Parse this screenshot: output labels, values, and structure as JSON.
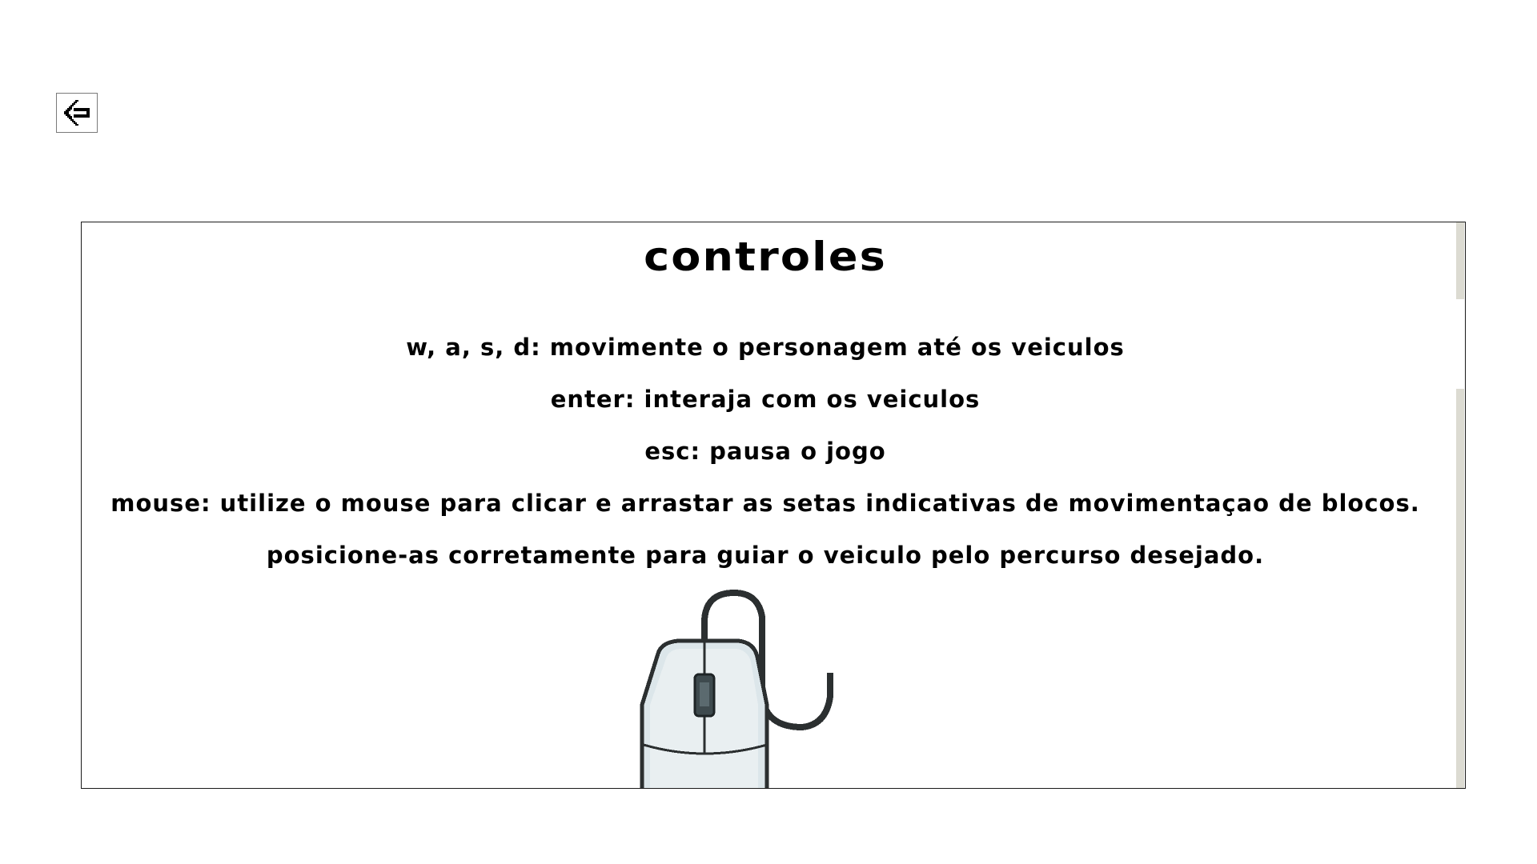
{
  "back_button": {
    "icon": "arrow-left-icon"
  },
  "controls_panel": {
    "title": "controles",
    "lines": [
      "w, a, s, d: movimente o personagem até os veiculos",
      "enter: interaja com os veiculos",
      "esc: pausa o jogo"
    ],
    "mouse_description": "mouse: utilize o mouse para clicar e arrastar as setas indicativas de movimentaçao de blocos. posicione-as corretamente para guiar o veiculo pelo percurso desejado.",
    "illustration": "computer-mouse-icon"
  },
  "colors": {
    "text": "#000000",
    "panel_border": "#1a1a1a",
    "scrollbar_thumb": "#dcdbd2",
    "mouse_body": "#dce6ea",
    "mouse_outline": "#2b2f30",
    "mouse_wheel": "#3e4a4e"
  }
}
